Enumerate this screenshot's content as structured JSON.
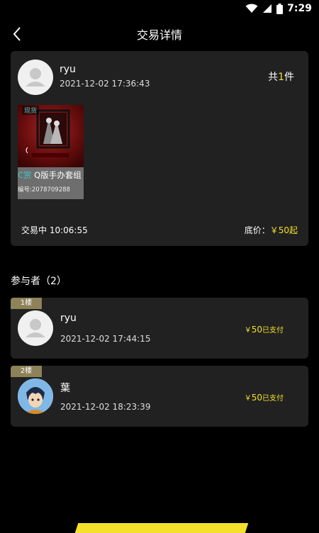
{
  "status_bar": {
    "time": "7:29",
    "icons": [
      "wifi-icon",
      "signal-icon",
      "battery-icon"
    ]
  },
  "header": {
    "title": "交易详情",
    "back_icon": "chevron-left-icon"
  },
  "trade": {
    "user": {
      "name": "ryu",
      "time": "2021-12-02 17:36:43"
    },
    "count": {
      "prefix": "共",
      "num": "1",
      "suffix": "件"
    },
    "product": {
      "badge": "现货",
      "name_prefix": "C赏",
      "name": " Q版手办套组",
      "code": "编号:2078709288"
    },
    "status": "交易中 10:06:55",
    "base_price": {
      "label": "底价：",
      "value": "￥50起"
    }
  },
  "participants": {
    "title": "参与者（2）",
    "items": [
      {
        "floor": "1楼",
        "name": "ryu",
        "time": "2021-12-02 17:44:15",
        "currency": "￥",
        "amount": "50",
        "status": "已支付"
      },
      {
        "floor": "2楼",
        "name": "葉",
        "time": "2021-12-02 18:23:39",
        "currency": "￥",
        "amount": "50",
        "status": "已支付"
      }
    ]
  },
  "colors": {
    "accent": "#f5e02c",
    "teal": "#3fc4c8",
    "card": "#212121",
    "floor_badge": "#8d8259"
  }
}
